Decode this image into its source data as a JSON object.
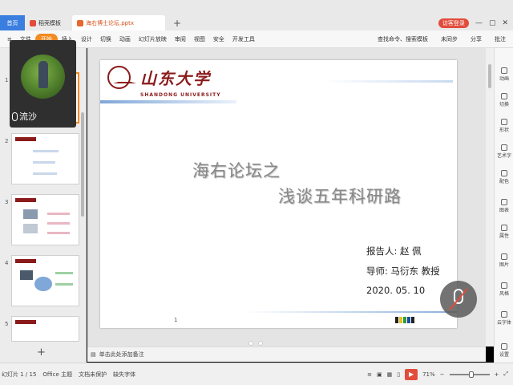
{
  "tabs": {
    "home": "首页",
    "template": "稻壳模板",
    "file": "海右博士论坛.pptx",
    "add": "+"
  },
  "window": {
    "login": "访客登录",
    "minimize": "—",
    "maximize": "▢",
    "close": "✕"
  },
  "ribbon": {
    "menu_icon": "≡",
    "file_menu": "文件",
    "items": [
      "开始",
      "插入",
      "设计",
      "切换",
      "动画",
      "幻灯片放映",
      "审阅",
      "视图",
      "安全",
      "开发工具"
    ],
    "active_item": "开始",
    "search": "查找命令、搜索模板",
    "sync": "未同步",
    "share": "分享",
    "comment": "批注"
  },
  "thumbnails": {
    "numbers": [
      "1",
      "2",
      "3",
      "4",
      "5"
    ],
    "add": "+"
  },
  "webcam": {
    "name": "流沙"
  },
  "slide": {
    "logo_cn": "山东大学",
    "logo_en": "SHANDONG UNIVERSITY",
    "title_line1": "海右论坛之",
    "title_line2": "浅谈五年科研路",
    "reporter": "报告人: 赵 佩",
    "advisor": "导师: 马衍东 教授",
    "date": "2020. 05. 10",
    "page_number": "1"
  },
  "notes": {
    "placeholder": "单击此处添加备注"
  },
  "right_panel": {
    "tools": [
      "动画",
      "切换",
      "形状",
      "艺术字",
      "配色",
      "图表",
      "属性",
      "图片",
      "风格",
      "云字体",
      "设置"
    ]
  },
  "status": {
    "slide_info": "幻灯片 1 / 15",
    "theme": "Office 主题",
    "protect": "文档未保护",
    "missing_font": "缺失字体",
    "zoom": "71%"
  },
  "colors": {
    "accent_orange": "#f28b22",
    "brand_red": "#8b1a1a",
    "tab_blue": "#3a7ee0"
  }
}
